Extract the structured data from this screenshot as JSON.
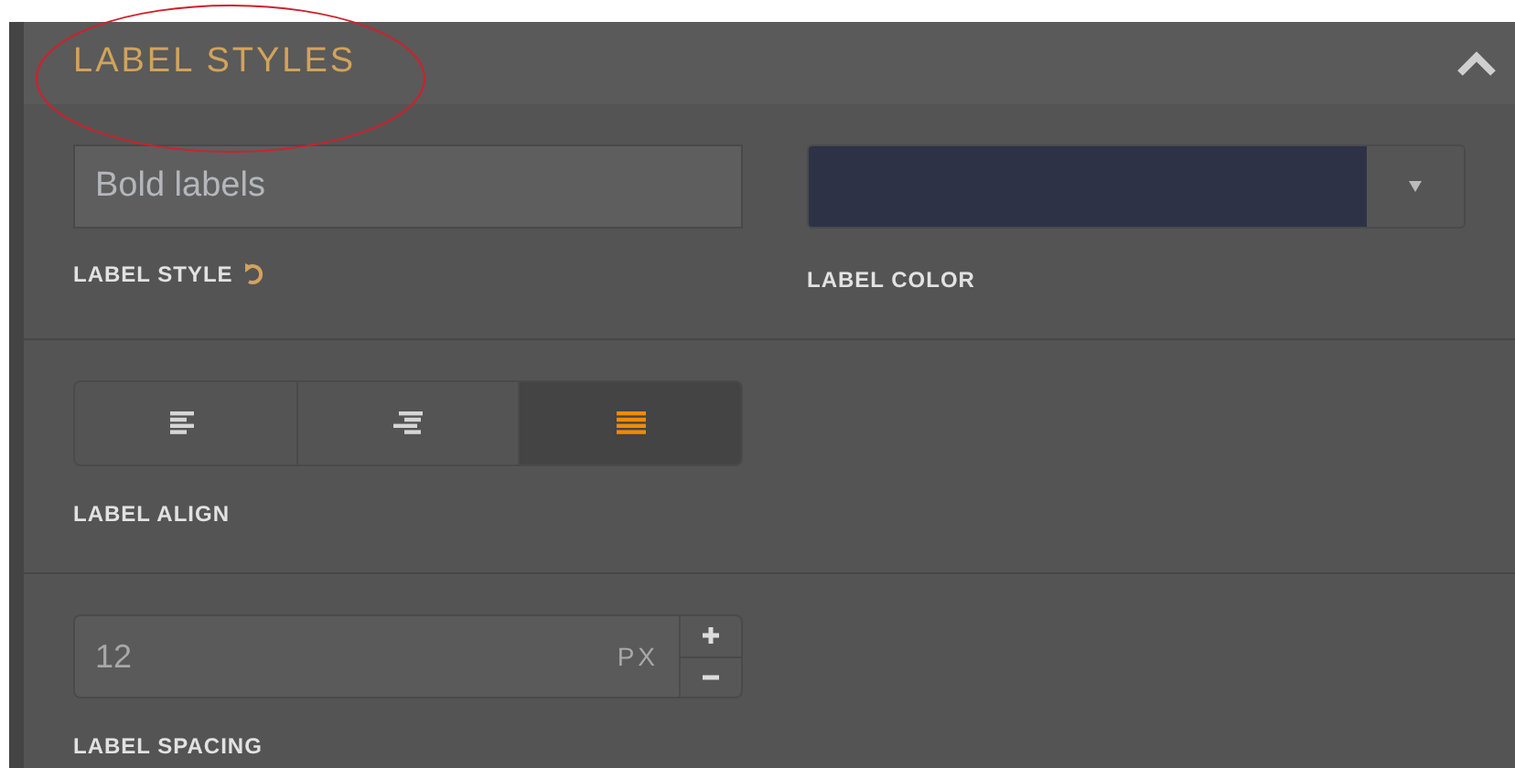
{
  "section": {
    "title": "LABEL STYLES",
    "expanded": true
  },
  "label_style": {
    "value": "Bold labels",
    "label": "LABEL STYLE"
  },
  "label_color": {
    "color": "#2d3246",
    "label": "LABEL COLOR"
  },
  "label_align": {
    "options": [
      {
        "kind": "left",
        "selected": false
      },
      {
        "kind": "right",
        "selected": false
      },
      {
        "kind": "justify",
        "selected": true
      }
    ],
    "label": "LABEL ALIGN"
  },
  "label_spacing": {
    "value": "12",
    "unit": "PX",
    "label": "LABEL SPACING"
  }
}
